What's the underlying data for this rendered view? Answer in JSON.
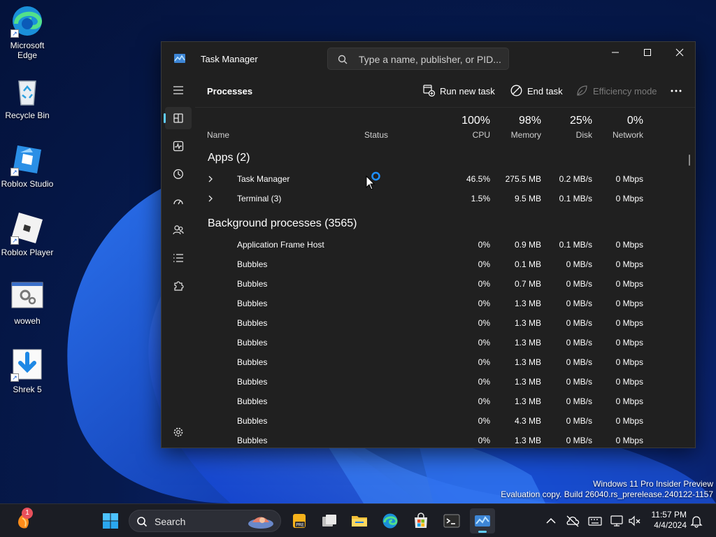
{
  "desktop": {
    "icons": [
      {
        "label": "Microsoft Edge"
      },
      {
        "label": "Recycle Bin"
      },
      {
        "label": "Roblox Studio"
      },
      {
        "label": "Roblox Player"
      },
      {
        "label": "woweh"
      },
      {
        "label": "Shrek 5"
      }
    ],
    "watermark": {
      "line1": "Windows 11 Pro Insider Preview",
      "line2": "Evaluation copy. Build 26040.rs_prerelease.240122-1157"
    }
  },
  "window": {
    "title": "Task Manager",
    "search_placeholder": "Type a name, publisher, or PID...",
    "page_title": "Processes",
    "toolbar": {
      "run_new_task": "Run new task",
      "end_task": "End task",
      "efficiency_mode": "Efficiency mode"
    },
    "columns": {
      "name": "Name",
      "status": "Status",
      "cpu_pct": "100%",
      "cpu": "CPU",
      "memory_pct": "98%",
      "memory": "Memory",
      "disk_pct": "25%",
      "disk": "Disk",
      "network_pct": "0%",
      "network": "Network"
    },
    "groups": {
      "apps": "Apps (2)",
      "background": "Background processes (3565)"
    },
    "apps": [
      {
        "name": "Task Manager",
        "cpu": "46.5%",
        "memory": "275.5 MB",
        "disk": "0.2 MB/s",
        "network": "0 Mbps"
      },
      {
        "name": "Terminal (3)",
        "cpu": "1.5%",
        "memory": "9.5 MB",
        "disk": "0.1 MB/s",
        "network": "0 Mbps"
      }
    ],
    "background": [
      {
        "name": "Application Frame Host",
        "cpu": "0%",
        "memory": "0.9 MB",
        "disk": "0.1 MB/s",
        "network": "0 Mbps"
      },
      {
        "name": "Bubbles",
        "cpu": "0%",
        "memory": "0.1 MB",
        "disk": "0 MB/s",
        "network": "0 Mbps"
      },
      {
        "name": "Bubbles",
        "cpu": "0%",
        "memory": "0.7 MB",
        "disk": "0 MB/s",
        "network": "0 Mbps"
      },
      {
        "name": "Bubbles",
        "cpu": "0%",
        "memory": "1.3 MB",
        "disk": "0 MB/s",
        "network": "0 Mbps"
      },
      {
        "name": "Bubbles",
        "cpu": "0%",
        "memory": "1.3 MB",
        "disk": "0 MB/s",
        "network": "0 Mbps"
      },
      {
        "name": "Bubbles",
        "cpu": "0%",
        "memory": "1.3 MB",
        "disk": "0 MB/s",
        "network": "0 Mbps"
      },
      {
        "name": "Bubbles",
        "cpu": "0%",
        "memory": "1.3 MB",
        "disk": "0 MB/s",
        "network": "0 Mbps"
      },
      {
        "name": "Bubbles",
        "cpu": "0%",
        "memory": "1.3 MB",
        "disk": "0 MB/s",
        "network": "0 Mbps"
      },
      {
        "name": "Bubbles",
        "cpu": "0%",
        "memory": "1.3 MB",
        "disk": "0 MB/s",
        "network": "0 Mbps"
      },
      {
        "name": "Bubbles",
        "cpu": "0%",
        "memory": "4.3 MB",
        "disk": "0 MB/s",
        "network": "0 Mbps"
      },
      {
        "name": "Bubbles",
        "cpu": "0%",
        "memory": "1.3 MB",
        "disk": "0 MB/s",
        "network": "0 Mbps"
      }
    ]
  },
  "taskbar": {
    "search_label": "Search",
    "notification_count": "1",
    "time": "11:57 PM",
    "date": "4/4/2024"
  },
  "colors": {
    "accent": "#60cdff",
    "window_bg": "#202020",
    "taskbar_bg": "#1b1d24"
  }
}
